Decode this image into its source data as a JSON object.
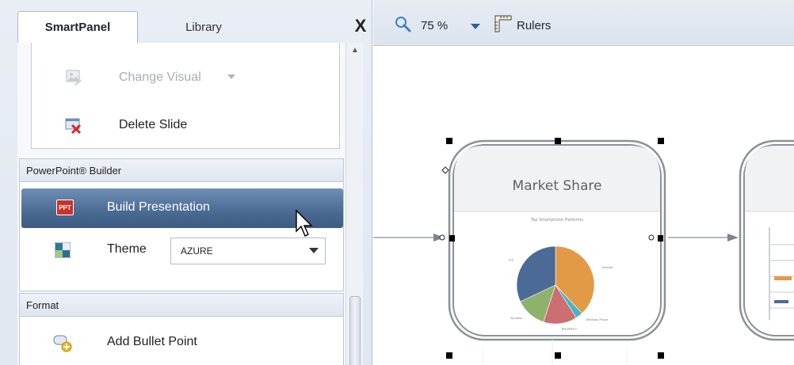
{
  "tabs": [
    {
      "label": "SmartPanel",
      "active": true
    },
    {
      "label": "Library",
      "active": false
    }
  ],
  "panel_close_label": "X",
  "visual_group": {
    "change_visual_label": "Change Visual",
    "delete_slide_label": "Delete Slide"
  },
  "powerpoint_builder": {
    "header": "PowerPoint® Builder",
    "build_label": "Build Presentation",
    "ppt_badge": "PPT",
    "theme_label": "Theme",
    "theme_value": "AZURE"
  },
  "format_group": {
    "header": "Format",
    "add_bullet_label": "Add Bullet Point"
  },
  "toolbar": {
    "zoom_value": "75 %",
    "rulers_label": "Rulers"
  },
  "slides": [
    {
      "title": "Market Share",
      "chart_title": "Top Smartphone Platforms"
    }
  ],
  "pie_slices": [
    {
      "label": "Android",
      "value": 38,
      "color": "#e39a46"
    },
    {
      "label": "Windows Phone",
      "value": 3,
      "color": "#46b4c8"
    },
    {
      "label": "BlackBerry",
      "value": 14,
      "color": "#cc6e72"
    },
    {
      "label": "Symbian",
      "value": 13,
      "color": "#8fb26a"
    },
    {
      "label": "iOS",
      "value": 32,
      "color": "#4c6a96"
    }
  ],
  "colors": {
    "accent_selected": "#4a6a92",
    "panel_bg": "#e5eaf1",
    "handle": "#000000"
  }
}
